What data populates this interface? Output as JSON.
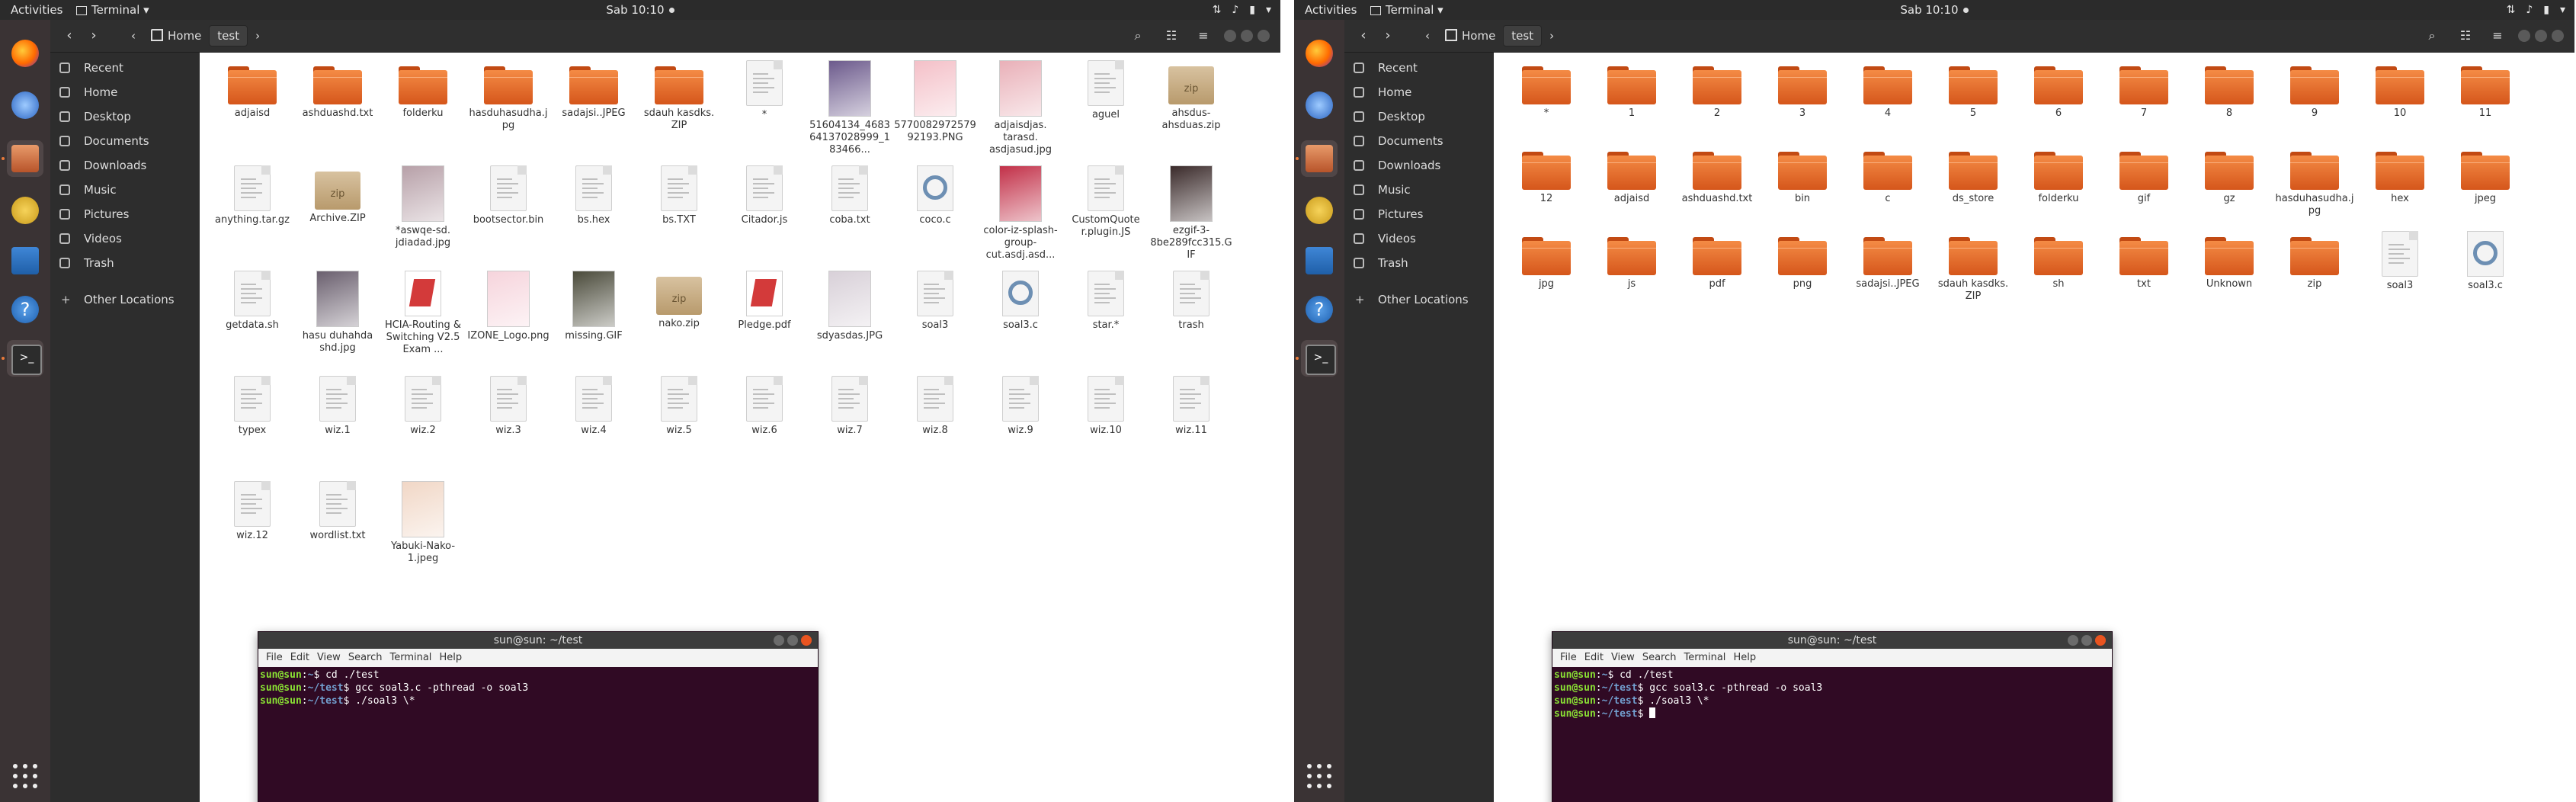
{
  "topbar": {
    "activities": "Activities",
    "app_menu": "Terminal",
    "clock": "Sab 10:10"
  },
  "sidebar": {
    "items": [
      {
        "label": "Recent",
        "icon": "clock-icon"
      },
      {
        "label": "Home",
        "icon": "home-icon"
      },
      {
        "label": "Desktop",
        "icon": "desktop-icon"
      },
      {
        "label": "Documents",
        "icon": "documents-icon"
      },
      {
        "label": "Downloads",
        "icon": "downloads-icon"
      },
      {
        "label": "Music",
        "icon": "music-icon"
      },
      {
        "label": "Pictures",
        "icon": "pictures-icon"
      },
      {
        "label": "Videos",
        "icon": "videos-icon"
      },
      {
        "label": "Trash",
        "icon": "trash-icon"
      }
    ],
    "other_locations": "Other Locations"
  },
  "path": {
    "home": "Home",
    "current": "test"
  },
  "left_files": [
    {
      "name": "adjaisd",
      "kind": "folder"
    },
    {
      "name": "ashduashd.txt",
      "kind": "folder"
    },
    {
      "name": "folderku",
      "kind": "folder"
    },
    {
      "name": "hasduhasudha.jpg",
      "kind": "folder"
    },
    {
      "name": "sadajsi..JPEG",
      "kind": "folder"
    },
    {
      "name": "sdauh kasdks. ZIP",
      "kind": "folder"
    },
    {
      "name": "*",
      "kind": "doc"
    },
    {
      "name": "51604134_468364137028999_183466...",
      "kind": "photo",
      "color": "#6c5a8c"
    },
    {
      "name": "577008297257992193.PNG",
      "kind": "photo",
      "color": "#f4c0c8"
    },
    {
      "name": "adjaisdjas. tarasd. asdjasud.jpg",
      "kind": "photo",
      "color": "#e9b0b8"
    },
    {
      "name": "aguel",
      "kind": "doc"
    },
    {
      "name": "ahsdus-ahsduas.zip",
      "kind": "zip"
    },
    {
      "name": "anything.tar.gz",
      "kind": "doc"
    },
    {
      "name": "Archive.ZIP",
      "kind": "zip"
    },
    {
      "name": "*aswqe-sd. jdiadad.jpg",
      "kind": "photo",
      "color": "#b7a0a8"
    },
    {
      "name": "bootsector.bin",
      "kind": "doc"
    },
    {
      "name": "bs.hex",
      "kind": "doc"
    },
    {
      "name": "bs.TXT",
      "kind": "doc"
    },
    {
      "name": "Citador.js",
      "kind": "doc"
    },
    {
      "name": "coba.txt",
      "kind": "doc"
    },
    {
      "name": "coco.c",
      "kind": "c"
    },
    {
      "name": "color-iz-splash-group-cut.asdj.asd...",
      "kind": "photo",
      "color": "#c23048"
    },
    {
      "name": "CustomQuote r.plugin.JS",
      "kind": "doc"
    },
    {
      "name": "ezgif-3-8be289fcc315.GIF",
      "kind": "photo",
      "color": "#3a2a2a"
    },
    {
      "name": "getdata.sh",
      "kind": "doc"
    },
    {
      "name": "hasu duhahda shd.jpg",
      "kind": "photo",
      "color": "#6a5f6e"
    },
    {
      "name": "HCIA-Routing & Switching V2.5 Exam ...",
      "kind": "pdf"
    },
    {
      "name": "IZONE_Logo.png",
      "kind": "photo",
      "color": "#f6d4dc"
    },
    {
      "name": "missing.GIF",
      "kind": "photo",
      "color": "#4a4a3a"
    },
    {
      "name": "nako.zip",
      "kind": "zip"
    },
    {
      "name": "Pledge.pdf",
      "kind": "pdf"
    },
    {
      "name": "sdyasdas.JPG",
      "kind": "photo",
      "color": "#d8d0d8"
    },
    {
      "name": "soal3",
      "kind": "doc"
    },
    {
      "name": "soal3.c",
      "kind": "c"
    },
    {
      "name": "star.*",
      "kind": "doc"
    },
    {
      "name": "trash",
      "kind": "doc"
    },
    {
      "name": "typex",
      "kind": "doc"
    },
    {
      "name": "wiz.1",
      "kind": "doc"
    },
    {
      "name": "wiz.2",
      "kind": "doc"
    },
    {
      "name": "wiz.3",
      "kind": "doc"
    },
    {
      "name": "wiz.4",
      "kind": "doc"
    },
    {
      "name": "wiz.5",
      "kind": "doc"
    },
    {
      "name": "wiz.6",
      "kind": "doc"
    },
    {
      "name": "wiz.7",
      "kind": "doc"
    },
    {
      "name": "wiz.8",
      "kind": "doc"
    },
    {
      "name": "wiz.9",
      "kind": "doc"
    },
    {
      "name": "wiz.10",
      "kind": "doc"
    },
    {
      "name": "wiz.11",
      "kind": "doc"
    },
    {
      "name": "wiz.12",
      "kind": "doc"
    },
    {
      "name": "wordlist.txt",
      "kind": "doc"
    },
    {
      "name": "Yabuki-Nako-1.jpeg",
      "kind": "photo",
      "color": "#f1d7c6"
    }
  ],
  "right_files": [
    {
      "name": "*",
      "kind": "folder"
    },
    {
      "name": "1",
      "kind": "folder"
    },
    {
      "name": "2",
      "kind": "folder"
    },
    {
      "name": "3",
      "kind": "folder"
    },
    {
      "name": "4",
      "kind": "folder"
    },
    {
      "name": "5",
      "kind": "folder"
    },
    {
      "name": "6",
      "kind": "folder"
    },
    {
      "name": "7",
      "kind": "folder"
    },
    {
      "name": "8",
      "kind": "folder"
    },
    {
      "name": "9",
      "kind": "folder"
    },
    {
      "name": "10",
      "kind": "folder"
    },
    {
      "name": "11",
      "kind": "folder"
    },
    {
      "name": "12",
      "kind": "folder"
    },
    {
      "name": "adjaisd",
      "kind": "folder"
    },
    {
      "name": "ashduashd.txt",
      "kind": "folder"
    },
    {
      "name": "bin",
      "kind": "folder"
    },
    {
      "name": "c",
      "kind": "folder"
    },
    {
      "name": "ds_store",
      "kind": "folder"
    },
    {
      "name": "folderku",
      "kind": "folder"
    },
    {
      "name": "gif",
      "kind": "folder"
    },
    {
      "name": "gz",
      "kind": "folder"
    },
    {
      "name": "hasduhasudha.jpg",
      "kind": "folder"
    },
    {
      "name": "hex",
      "kind": "folder"
    },
    {
      "name": "jpeg",
      "kind": "folder"
    },
    {
      "name": "jpg",
      "kind": "folder"
    },
    {
      "name": "js",
      "kind": "folder"
    },
    {
      "name": "pdf",
      "kind": "folder"
    },
    {
      "name": "png",
      "kind": "folder"
    },
    {
      "name": "sadajsi..JPEG",
      "kind": "folder"
    },
    {
      "name": "sdauh kasdks. ZIP",
      "kind": "folder"
    },
    {
      "name": "sh",
      "kind": "folder"
    },
    {
      "name": "txt",
      "kind": "folder"
    },
    {
      "name": "Unknown",
      "kind": "folder"
    },
    {
      "name": "zip",
      "kind": "folder"
    },
    {
      "name": "soal3",
      "kind": "doc"
    },
    {
      "name": "soal3.c",
      "kind": "c"
    }
  ],
  "terminal": {
    "title": "sun@sun: ~/test",
    "menu": [
      "File",
      "Edit",
      "View",
      "Search",
      "Terminal",
      "Help"
    ],
    "user_host": "sun@sun",
    "left_lines": [
      {
        "path": "~",
        "cmd": "cd ./test"
      },
      {
        "path": "~/test",
        "cmd": "gcc soal3.c -pthread -o soal3"
      },
      {
        "path": "~/test",
        "cmd": "./soal3 \\*"
      }
    ],
    "right_lines": [
      {
        "path": "~",
        "cmd": "cd ./test"
      },
      {
        "path": "~/test",
        "cmd": "gcc soal3.c -pthread -o soal3"
      },
      {
        "path": "~/test",
        "cmd": "./soal3 \\*"
      },
      {
        "path": "~/test",
        "cmd": ""
      }
    ]
  },
  "colors": {
    "folder": "#e8692a",
    "terminal_bg": "#300a24",
    "prompt_user": "#8ae234",
    "prompt_path": "#729fcf"
  }
}
